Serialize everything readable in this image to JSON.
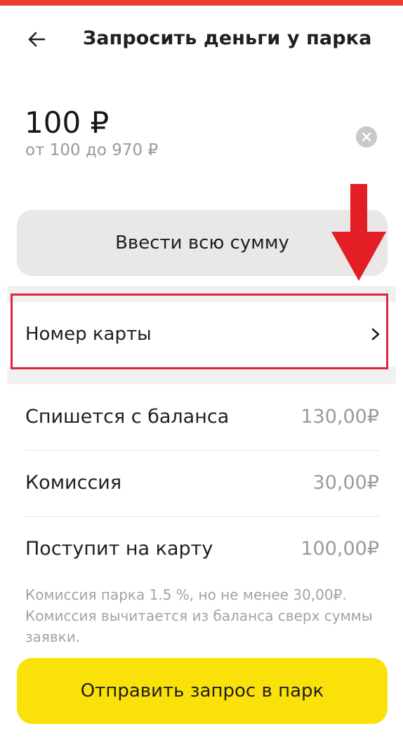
{
  "header": {
    "title": "Запросить деньги у парка",
    "back_icon": "arrow-left-icon"
  },
  "amount": {
    "value": "100 ₽",
    "range": "от 100 до 970 ₽",
    "clear_icon": "clear-icon"
  },
  "full_amount_button": {
    "label": "Ввести всю сумму"
  },
  "annotation": {
    "arrow_color": "#e31e24",
    "highlight_color": "#e0263a"
  },
  "card_row": {
    "label": "Номер карты",
    "chevron_icon": "chevron-right-icon"
  },
  "summary": {
    "rows": [
      {
        "label": "Спишется с баланса",
        "value": "130,00₽"
      },
      {
        "label": "Комиссия",
        "value": "30,00₽"
      },
      {
        "label": "Поступит на карту",
        "value": "100,00₽"
      }
    ]
  },
  "note": {
    "text": "Комиссия парка 1.5 %, но не менее 30,00₽. Комиссия вычитается из баланса сверх суммы заявки."
  },
  "submit_button": {
    "label": "Отправить запрос в парк",
    "color": "#fbe10a"
  },
  "colors": {
    "top_strip": "#ee3b2f",
    "secondary_text": "#9b9b9b",
    "button_gray": "#e9e8e6"
  }
}
